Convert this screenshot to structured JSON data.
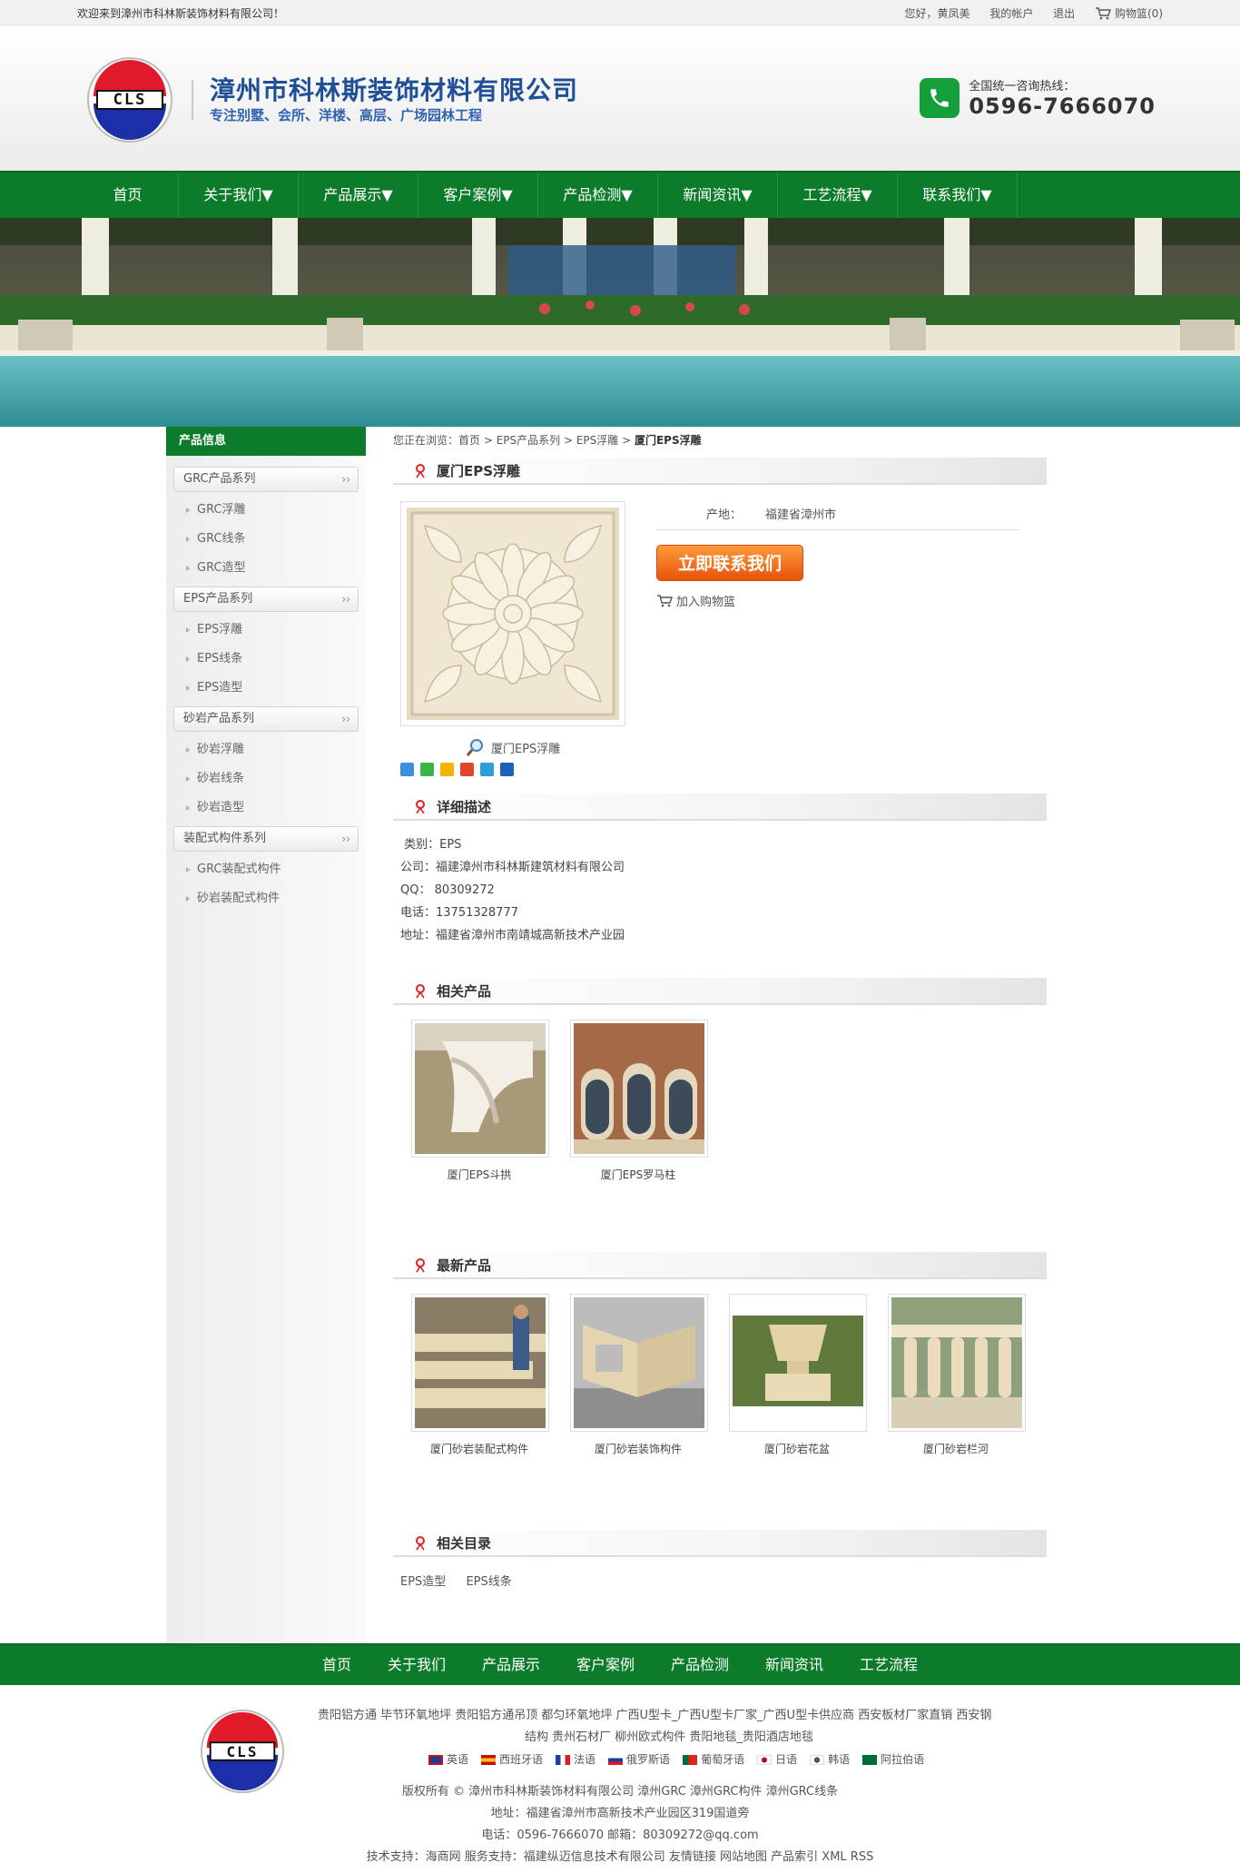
{
  "topbar": {
    "welcome": "欢迎来到漳州市科林斯装饰材料有限公司！",
    "greeting": "您好，黄凤美",
    "account": "我的帐户",
    "logout": "退出",
    "cart": "购物篮(0)"
  },
  "header": {
    "logo_text": "CLS",
    "company": "漳州市科林斯装饰材料有限公司",
    "slogan": "专注别墅、会所、洋楼、高层、广场园林工程",
    "hotline_label": "全国统一咨询热线：",
    "hotline_number": "0596-7666070"
  },
  "nav": [
    "首页",
    "关于我们▼",
    "产品展示▼",
    "客户案例▼",
    "产品检测▼",
    "新闻资讯▼",
    "工艺流程▼",
    "联系我们▼"
  ],
  "sidebar": {
    "title": "产品信息",
    "categories": [
      {
        "label": "GRC产品系列",
        "items": [
          "GRC浮雕",
          "GRC线条",
          "GRC造型"
        ]
      },
      {
        "label": "EPS产品系列",
        "items": [
          "EPS浮雕",
          "EPS线条",
          "EPS造型"
        ]
      },
      {
        "label": "砂岩产品系列",
        "items": [
          "砂岩浮雕",
          "砂岩线条",
          "砂岩造型"
        ]
      },
      {
        "label": "装配式构件系列",
        "items": [
          "GRC装配式构件",
          "砂岩装配式构件"
        ]
      }
    ],
    "arrow": "››"
  },
  "breadcrumb": {
    "prefix": "您正在浏览：",
    "home": "首页",
    "l1": "EPS产品系列",
    "l2": "EPS浮雕",
    "current": "厦门EPS浮雕",
    "sep": " > "
  },
  "product": {
    "title": "厦门EPS浮雕",
    "origin_label": "产地：",
    "origin_value": "福建省漳州市",
    "contact_button": "立即联系我们",
    "add_cart": "加入购物篮",
    "zoom_caption": "厦门EPS浮雕"
  },
  "detail": {
    "title": "详细描述",
    "lines": [
      " 类别：EPS",
      "公司：福建漳州市科林斯建筑材料有限公司",
      "QQ： 80309272",
      "电话：13751328777",
      "地址：福建省漳州市南靖城高新技术产业园"
    ]
  },
  "related": {
    "title": "相关产品",
    "items": [
      "厦门EPS斗拱",
      "厦门EPS罗马柱"
    ]
  },
  "latest": {
    "title": "最新产品",
    "items": [
      "厦门砂岩装配式构件",
      "厦门砂岩装饰构件",
      "厦门砂岩花盆",
      "厦门砂岩栏河"
    ]
  },
  "related_dir": {
    "title": "相关目录",
    "items": [
      "EPS造型",
      "EPS线条"
    ]
  },
  "footer_nav": [
    "首页",
    "关于我们",
    "产品展示",
    "客户案例",
    "产品检测",
    "新闻资讯",
    "工艺流程"
  ],
  "footer": {
    "links_line1": "贵阳铝方通 毕节环氧地坪 贵阳铝方通吊顶 都匀环氧地坪 广西U型卡_广西U型卡厂家_广西U型卡供应商 西安板材厂家直销 西安钢",
    "links_line2": "结构 贵州石材厂 柳州欧式构件 贵阳地毯_贵阳酒店地毯",
    "languages": [
      "英语",
      "西班牙语",
      "法语",
      "俄罗斯语",
      "葡萄牙语",
      "日语",
      "韩语",
      "阿拉伯语"
    ],
    "copyright": "版权所有 © 漳州市科林斯装饰材料有限公司 漳州GRC 漳州GRC构件 漳州GRC线条",
    "address": "地址：福建省漳州市高新技术产业园区319国道旁",
    "contact": "电话：0596-7666070 邮箱：80309272@qq.com",
    "support": "技术支持：海商网 服务支持：福建纵迈信息技术有限公司 友情链接 网站地图 产品索引 XML RSS"
  },
  "colors": {
    "brand_green": "#0d7c2a",
    "title_blue": "#1f4f96",
    "button_orange": "#e8530a"
  }
}
